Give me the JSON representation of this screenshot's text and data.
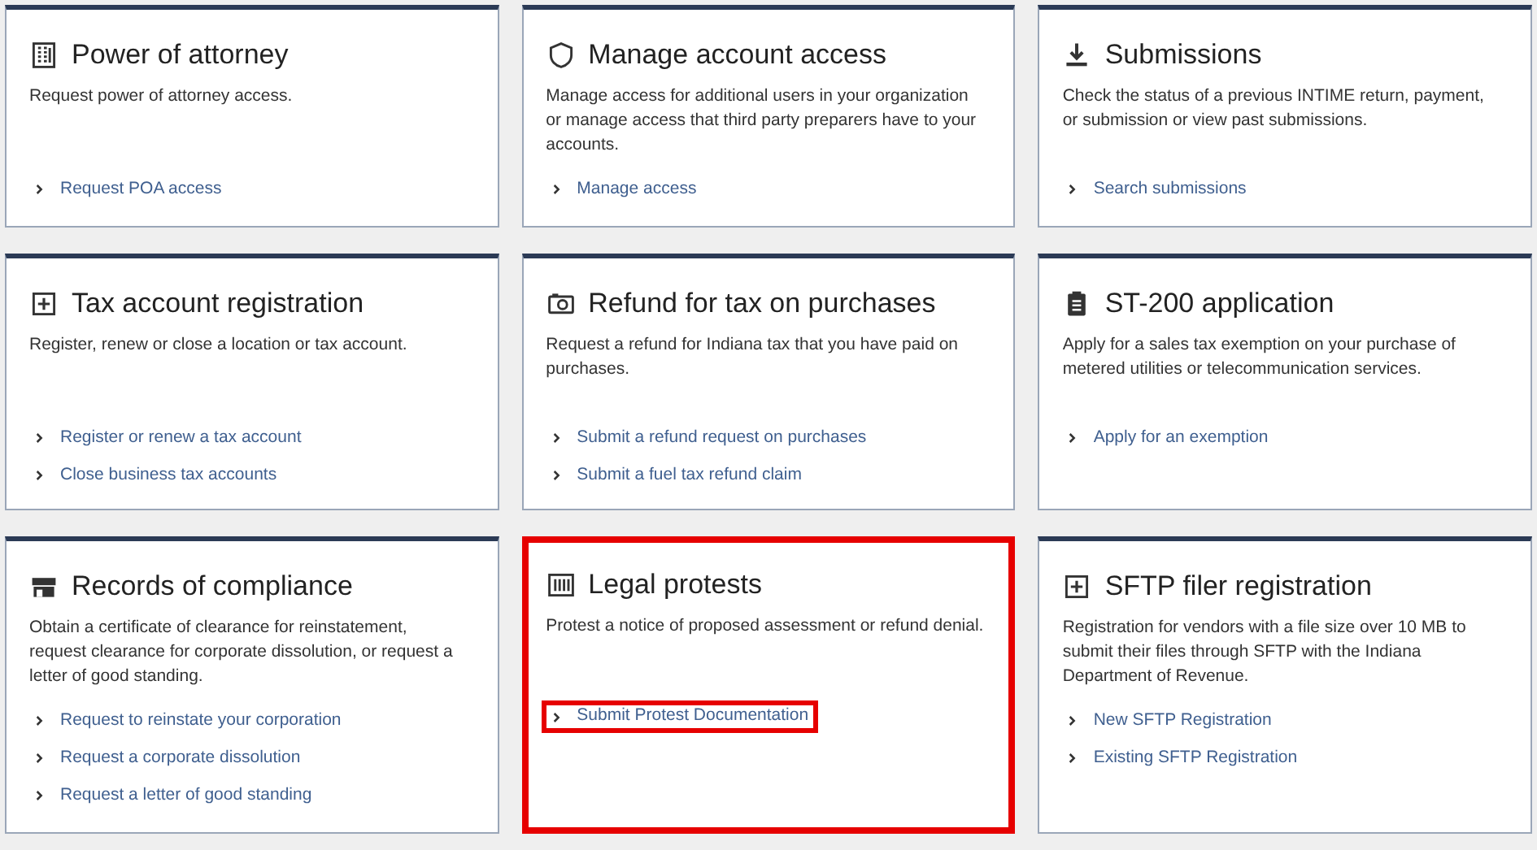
{
  "cards": [
    {
      "title": "Power of attorney",
      "description": "Request power of attorney access.",
      "highlighted": false,
      "links": [
        {
          "label": "Request POA access",
          "highlighted": false
        }
      ]
    },
    {
      "title": "Manage account access",
      "description": "Manage access for additional users in your organization or manage access that third party preparers have to your accounts.",
      "highlighted": false,
      "links": [
        {
          "label": "Manage access",
          "highlighted": false
        }
      ]
    },
    {
      "title": "Submissions",
      "description": "Check the status of a previous INTIME return, payment, or submission or view past submissions.",
      "highlighted": false,
      "links": [
        {
          "label": "Search submissions",
          "highlighted": false
        }
      ]
    },
    {
      "title": "Tax account registration",
      "description": "Register, renew or close a location or tax account.",
      "highlighted": false,
      "links": [
        {
          "label": "Register or renew a tax account",
          "highlighted": false
        },
        {
          "label": "Close business tax accounts",
          "highlighted": false
        }
      ]
    },
    {
      "title": "Refund for tax on purchases",
      "description": "Request a refund for Indiana tax that you have paid on purchases.",
      "highlighted": false,
      "links": [
        {
          "label": "Submit a refund request on purchases",
          "highlighted": false
        },
        {
          "label": "Submit a fuel tax refund claim",
          "highlighted": false
        }
      ]
    },
    {
      "title": "ST-200 application",
      "description": "Apply for a sales tax exemption on your purchase of metered utilities or telecommunication services.",
      "highlighted": false,
      "links": [
        {
          "label": "Apply for an exemption",
          "highlighted": false
        }
      ]
    },
    {
      "title": "Records of compliance",
      "description": "Obtain a certificate of clearance for reinstatement, request clearance for corporate dissolution, or request a letter of good standing.",
      "highlighted": false,
      "links": [
        {
          "label": "Request to reinstate your corporation",
          "highlighted": false
        },
        {
          "label": "Request a corporate dissolution",
          "highlighted": false
        },
        {
          "label": "Request a letter of good standing",
          "highlighted": false
        }
      ]
    },
    {
      "title": "Legal protests",
      "description": "Protest a notice of proposed assessment or refund denial.",
      "highlighted": true,
      "links": [
        {
          "label": "Submit Protest Documentation",
          "highlighted": true
        }
      ]
    },
    {
      "title": "SFTP filer registration",
      "description": "Registration for vendors with a file size over 10 MB to submit their files through SFTP with the Indiana Department of Revenue.",
      "highlighted": false,
      "links": [
        {
          "label": "New SFTP Registration",
          "highlighted": false
        },
        {
          "label": "Existing SFTP Registration",
          "highlighted": false
        }
      ]
    }
  ]
}
